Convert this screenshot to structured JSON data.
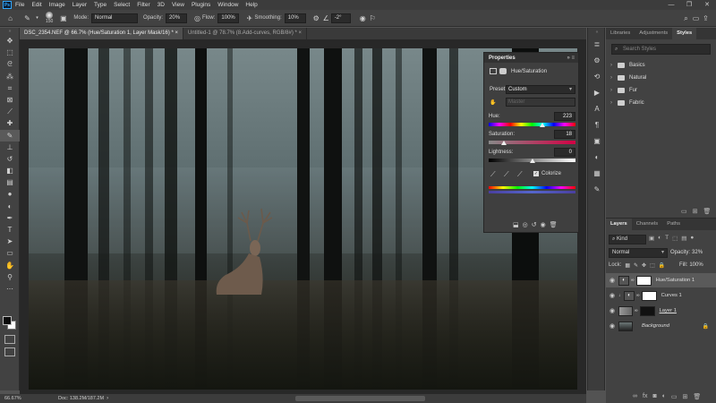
{
  "menu": {
    "items": [
      "File",
      "Edit",
      "Image",
      "Layer",
      "Type",
      "Select",
      "Filter",
      "3D",
      "View",
      "Plugins",
      "Window",
      "Help"
    ]
  },
  "options": {
    "brush_size": "150",
    "mode_label": "Mode:",
    "mode_value": "Normal",
    "opacity_label": "Opacity:",
    "opacity_value": "20%",
    "flow_label": "Flow:",
    "flow_value": "100%",
    "smoothing_label": "Smoothing:",
    "smoothing_value": "10%",
    "angle_value": "-2°"
  },
  "tabs": [
    {
      "label": "DSC_2354.NEF @ 66.7% (Hue/Saturation 1, Layer Mask/16) *  ×"
    },
    {
      "label": "Untitled-1 @ 78.7% (8.Add-curves, RGB/8#) *  ×"
    }
  ],
  "status": {
    "zoom": "66.67%",
    "doc": "Doc: 138.2M/187.2M"
  },
  "properties": {
    "title": "Properties",
    "adjustment": "Hue/Saturation",
    "preset_label": "Preset:",
    "preset_value": "Custom",
    "master": "Master",
    "hue_label": "Hue:",
    "hue_value": "223",
    "hue_level": 223,
    "sat_label": "Saturation:",
    "sat_value": "18",
    "sat_level": 18,
    "light_label": "Lightness:",
    "light_value": "0",
    "light_level": 0,
    "colorize_label": "Colorize",
    "colorize": true
  },
  "styles_panel": {
    "tabs": [
      "Libraries",
      "Adjustments",
      "Styles"
    ],
    "search_placeholder": "Search Styles",
    "folders": [
      "Basics",
      "Natural",
      "Fur",
      "Fabric"
    ]
  },
  "layers_panel": {
    "tabs": [
      "Layers",
      "Channels",
      "Paths"
    ],
    "kind": "Kind",
    "blend": "Normal",
    "opacity_label": "Opacity:",
    "opacity_value": "32%",
    "lock_label": "Lock:",
    "fill_label": "Fill:",
    "fill_value": "100%",
    "layers": [
      {
        "name": "Hue/Saturation 1",
        "selected": true
      },
      {
        "name": "Curves 1",
        "selected": false
      },
      {
        "name": "Layer 1",
        "selected": false
      },
      {
        "name": "Background",
        "selected": false
      }
    ]
  }
}
